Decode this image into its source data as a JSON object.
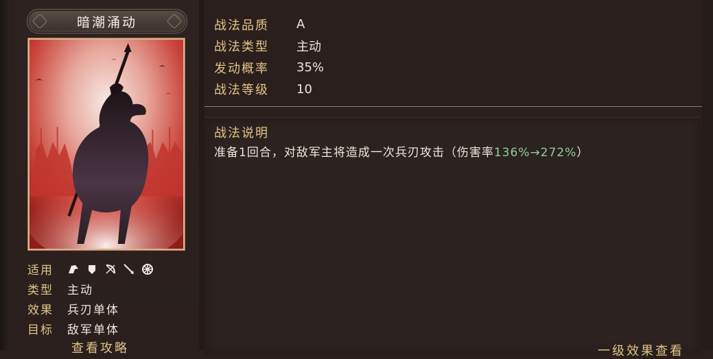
{
  "skill": {
    "name": "暗潮涌动",
    "attributes": {
      "applicable_label": "适用",
      "applicable_units": [
        "cavalry-icon",
        "shield-icon",
        "bow-icon",
        "spear-icon",
        "wheel-icon"
      ],
      "type_label": "类型",
      "type_value": "主动",
      "effect_label": "效果",
      "effect_value": "兵刃单体",
      "target_label": "目标",
      "target_value": "敌军单体"
    },
    "guide_link": "查看攻略",
    "info": [
      {
        "label": "战法品质",
        "value": "A"
      },
      {
        "label": "战法类型",
        "value": "主动"
      },
      {
        "label": "发动概率",
        "value": "35%"
      },
      {
        "label": "战法等级",
        "value": "10"
      }
    ],
    "description": {
      "title": "战法说明",
      "text_prefix": "准备1回合，对敌军主将造成一次兵刃攻击（伤害率",
      "rate": "136%→272%",
      "text_suffix": "）"
    },
    "level_effect_link": "一级效果查看"
  },
  "colors": {
    "gold": "#e1c487",
    "text": "#ece6da",
    "rate": "#8fcf9e",
    "art_red": "#c0302a"
  }
}
